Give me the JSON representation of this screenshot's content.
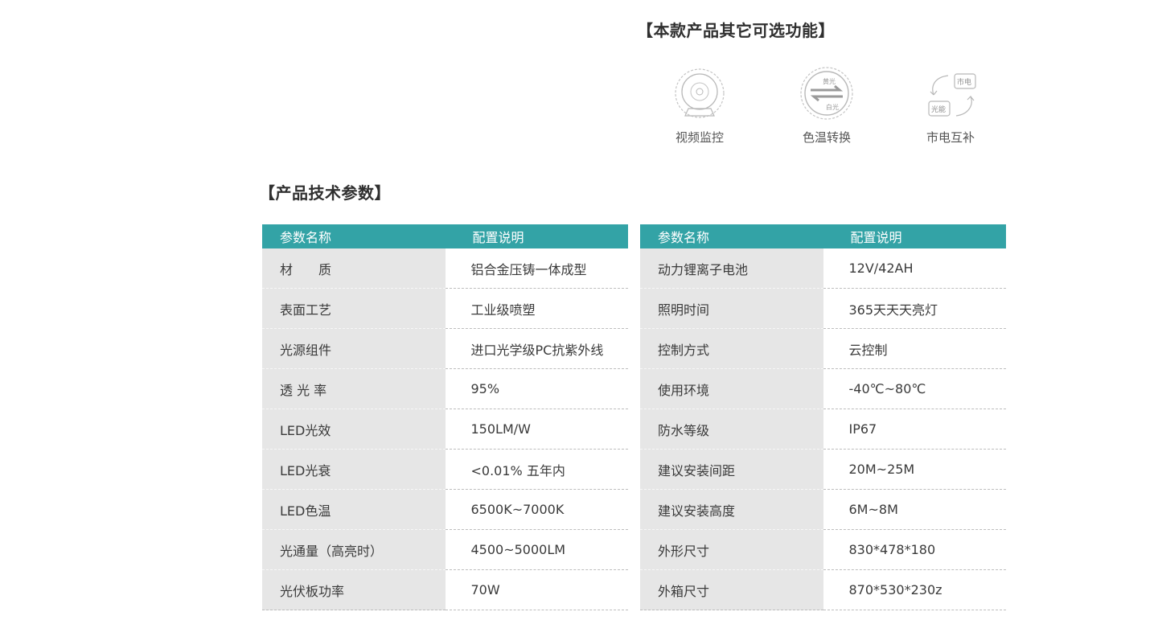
{
  "features": {
    "title": "【本款产品其它可选功能】",
    "items": [
      {
        "label": "视频监控",
        "icon": "camera-icon"
      },
      {
        "label": "色温转换",
        "icon": "color-temperature-icon",
        "icon_text": [
          "黄光",
          "白光"
        ]
      },
      {
        "label": "市电互补",
        "icon": "mains-complement-icon",
        "icon_text": [
          "市电",
          "光能"
        ]
      }
    ]
  },
  "specs": {
    "title": "【产品技术参数】",
    "header": {
      "name": "参数名称",
      "value": "配置说明"
    },
    "left_rows": [
      {
        "name": "材　　质",
        "value": "铝合金压铸一体成型"
      },
      {
        "name": "表面工艺",
        "value": "工业级喷塑"
      },
      {
        "name": "光源组件",
        "value": "进口光学级PC抗紫外线"
      },
      {
        "name": "透 光 率",
        "value": "95%"
      },
      {
        "name": "LED光效",
        "value": "150LM/W"
      },
      {
        "name": "LED光衰",
        "value": "<0.01% 五年内"
      },
      {
        "name": "LED色温",
        "value": "6500K~7000K"
      },
      {
        "name": "光通量（高亮时）",
        "value": "4500~5000LM"
      },
      {
        "name": "光伏板功率",
        "value": "70W"
      }
    ],
    "right_rows": [
      {
        "name": "动力锂离子电池",
        "value": "12V/42AH"
      },
      {
        "name": "照明时间",
        "value": "365天天天亮灯"
      },
      {
        "name": "控制方式",
        "value": "云控制"
      },
      {
        "name": "使用环境",
        "value": "-40℃~80℃"
      },
      {
        "name": "防水等级",
        "value": "IP67"
      },
      {
        "name": "建议安装间距",
        "value": "20M~25M"
      },
      {
        "name": "建议安装高度",
        "value": "6M~8M"
      },
      {
        "name": "外形尺寸",
        "value": "830*478*180"
      },
      {
        "name": "外箱尺寸",
        "value": "870*530*230z"
      }
    ]
  },
  "colors": {
    "header_bg": "#33a3a6",
    "name_col_bg": "#e6e6e6",
    "icon_stroke": "#b8b8b8"
  }
}
